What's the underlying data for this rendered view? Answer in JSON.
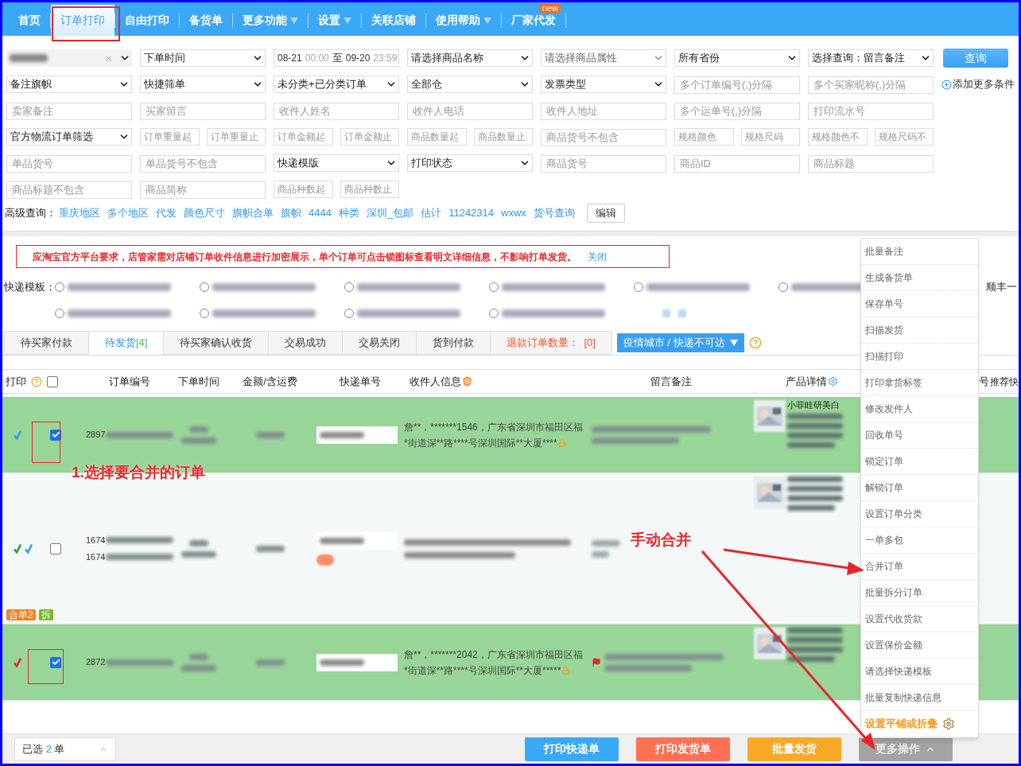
{
  "nav": {
    "items": [
      {
        "label": "首页",
        "selected": false,
        "dropdown": false
      },
      {
        "label": "订单打印",
        "selected": true,
        "dropdown": false
      },
      {
        "label": "自由打印",
        "selected": false,
        "dropdown": false
      },
      {
        "label": "备货单",
        "selected": false,
        "dropdown": false
      },
      {
        "label": "更多功能",
        "selected": false,
        "dropdown": true
      },
      {
        "label": "设置",
        "selected": false,
        "dropdown": true
      },
      {
        "label": "关联店铺",
        "selected": false,
        "dropdown": false
      },
      {
        "label": "使用帮助",
        "selected": false,
        "dropdown": true
      },
      {
        "label": "厂家代发",
        "selected": false,
        "dropdown": false,
        "badge": "new"
      }
    ]
  },
  "filters": {
    "rows": [
      {
        "cells": [
          {
            "kind": "redacted-select"
          },
          {
            "kind": "select",
            "value": "下单时间"
          },
          {
            "kind": "date",
            "from_date": "08-21",
            "from_time": "00:00",
            "sep": "至",
            "to_date": "09-20",
            "to_time": "23:59"
          },
          {
            "kind": "select",
            "value": "请选择商品名称"
          },
          {
            "kind": "muted-select",
            "value": "请选择商品属性"
          },
          {
            "kind": "select",
            "value": "所有省份"
          },
          {
            "kind": "select",
            "value": "选择查询：留言备注"
          }
        ],
        "action": {
          "kind": "button",
          "label": "查询"
        }
      },
      {
        "cells": [
          {
            "kind": "select",
            "value": "备注旗帜"
          },
          {
            "kind": "select",
            "value": "快捷筛单"
          },
          {
            "kind": "select",
            "value": "未分类+已分类订单"
          },
          {
            "kind": "select",
            "value": "全部仓"
          },
          {
            "kind": "select",
            "value": "发票类型"
          },
          {
            "kind": "input",
            "placeholder": "多个订单编号(,)分隔"
          },
          {
            "kind": "input",
            "placeholder": "多个买家昵称(,)分隔"
          }
        ],
        "action": {
          "kind": "link",
          "label": "添加更多条件"
        }
      },
      {
        "cells": [
          {
            "kind": "input",
            "placeholder": "卖家备注"
          },
          {
            "kind": "input",
            "placeholder": "买家留言"
          },
          {
            "kind": "input",
            "placeholder": "收件人姓名"
          },
          {
            "kind": "input",
            "placeholder": "收件人电话"
          },
          {
            "kind": "input",
            "placeholder": "收件人地址"
          },
          {
            "kind": "input",
            "placeholder": "多个运单号(,)分隔"
          },
          {
            "kind": "input",
            "placeholder": "打印流水号"
          }
        ]
      },
      {
        "cells": [
          {
            "kind": "select",
            "value": "官方物流订单筛选"
          },
          {
            "kind": "pair",
            "fields": [
              {
                "kind": "input",
                "placeholder": "订单重量起"
              },
              {
                "kind": "input",
                "placeholder": "订单重量止"
              }
            ]
          },
          {
            "kind": "pair",
            "fields": [
              {
                "kind": "input",
                "placeholder": "订单金额起"
              },
              {
                "kind": "input",
                "placeholder": "订单金额止"
              }
            ]
          },
          {
            "kind": "pair",
            "fields": [
              {
                "kind": "input",
                "placeholder": "商品数量起"
              },
              {
                "kind": "input",
                "placeholder": "商品数量止"
              }
            ]
          },
          {
            "kind": "input",
            "placeholder": "商品货号不包含"
          },
          {
            "kind": "pair",
            "fields": [
              {
                "kind": "input",
                "placeholder": "规格颜色"
              },
              {
                "kind": "input",
                "placeholder": "规格尺码"
              }
            ]
          },
          {
            "kind": "pair",
            "fields": [
              {
                "kind": "input",
                "placeholder": "规格颜色不"
              },
              {
                "kind": "input",
                "placeholder": "规格尺码不"
              }
            ]
          }
        ]
      },
      {
        "cells": [
          {
            "kind": "input",
            "placeholder": "单品货号"
          },
          {
            "kind": "input",
            "placeholder": "单品货号不包含"
          },
          {
            "kind": "select",
            "value": "快递模版"
          },
          {
            "kind": "select",
            "value": "打印状态"
          },
          {
            "kind": "input",
            "placeholder": "商品货号"
          },
          {
            "kind": "input",
            "placeholder": "商品ID"
          },
          {
            "kind": "input",
            "placeholder": "商品标题"
          }
        ]
      },
      {
        "cells": [
          {
            "kind": "input",
            "placeholder": "商品标题不包含"
          },
          {
            "kind": "input",
            "placeholder": "商品简称"
          },
          {
            "kind": "pair",
            "fields": [
              {
                "kind": "input",
                "placeholder": "商品种数起"
              },
              {
                "kind": "input",
                "placeholder": "商品种数止"
              }
            ]
          }
        ]
      }
    ]
  },
  "advanced": {
    "label": "高级查询：",
    "links": [
      "重庆地区",
      "多个地区",
      "代发",
      "颜色尺寸",
      "旗帜合单",
      "旗帜",
      "4444",
      "种类",
      "深圳_包邮",
      "估计",
      "11242314",
      "wxwx",
      "货号查询"
    ],
    "edit_button": "编辑"
  },
  "notice": {
    "text": "应淘宝官方平台要求，店管家需对店铺订单收件信息进行加密展示，单个订单可点击锁图标查看明文详细信息，不影响打单发货。",
    "close": "关闭"
  },
  "templates": {
    "label": "快递模板：",
    "rows": [
      {
        "options": [
          {
            "selected": false
          },
          {
            "selected": false
          },
          {
            "selected": false
          },
          {
            "selected": false
          },
          {
            "selected": false
          },
          {
            "selected": false
          }
        ],
        "trailing": "顺丰一"
      },
      {
        "options": [
          {
            "selected": false
          },
          {
            "selected": false
          },
          {
            "selected": false
          },
          {
            "selected": false
          }
        ]
      }
    ]
  },
  "tabs": [
    {
      "label": "待买家付款",
      "selected": false,
      "kind": "normal"
    },
    {
      "label": "待发货",
      "count": "[4]",
      "selected": true,
      "kind": "normal"
    },
    {
      "label": "待买家确认收货",
      "selected": false,
      "kind": "normal"
    },
    {
      "label": "交易成功",
      "selected": false,
      "kind": "normal"
    },
    {
      "label": "交易关闭",
      "selected": false,
      "kind": "normal"
    },
    {
      "label": "货到付款",
      "selected": false,
      "kind": "normal"
    },
    {
      "label": "退款订单数量：",
      "count": "[0]",
      "selected": false,
      "kind": "alert"
    }
  ],
  "tab_action": "疫情城市 / 快递不可达",
  "table": {
    "all_selected": false,
    "columns": [
      {
        "label": "打印",
        "kind": "print"
      },
      {
        "label": "订单编号",
        "kind": "text"
      },
      {
        "label": "下单时间",
        "kind": "text"
      },
      {
        "label": "金额/含运费",
        "kind": "text"
      },
      {
        "label": "快递单号",
        "kind": "text"
      },
      {
        "label": "收件人信息",
        "kind": "recipient"
      },
      {
        "label": "留言备注",
        "kind": "text"
      },
      {
        "label": "产品详情",
        "kind": "product"
      },
      {
        "label": "号",
        "kind": "end"
      },
      {
        "label": "推荐快",
        "kind": "text"
      }
    ],
    "rows": [
      {
        "selected": true,
        "marks": [
          {
            "color": "#29a3f0"
          }
        ],
        "order_numbers": [
          "2897"
        ],
        "recipient": "詹**，*******1546，广东省深圳市福田区福*街道深**路****号深圳国际**大厦****",
        "flag": false,
        "product_title": "小菲眭研美白"
      },
      {
        "selected": false,
        "marks": [
          {
            "color": "#2f9e2f"
          },
          {
            "color": "#29a3f0"
          }
        ],
        "order_numbers": [
          "1674",
          "1674"
        ],
        "flag": false,
        "tags": [
          {
            "label": "合单2",
            "color": "#f5811f"
          },
          {
            "label": "拆",
            "color": "#7bb62b"
          }
        ]
      },
      {
        "selected": true,
        "marks": [
          {
            "color": "#e8262a"
          }
        ],
        "order_numbers": [
          "2872"
        ],
        "recipient": "詹**，*******2042，广东省深圳市福田区福*街道深**路****号深圳国际**大厦*****",
        "flag": true
      }
    ]
  },
  "menu": {
    "items": [
      {
        "label": "批量备注",
        "kind": "item"
      },
      {
        "label": "生成备货单",
        "kind": "item"
      },
      {
        "label": "保存单号",
        "kind": "item"
      },
      {
        "label": "扫描发货",
        "kind": "item"
      },
      {
        "label": "扫描打印",
        "kind": "item"
      },
      {
        "label": "打印拿货标签",
        "kind": "item"
      },
      {
        "label": "修改发件人",
        "kind": "item"
      },
      {
        "label": "回收单号",
        "kind": "item"
      },
      {
        "label": "锁定订单",
        "kind": "item"
      },
      {
        "label": "解锁订单",
        "kind": "item"
      },
      {
        "label": "设置订单分类",
        "kind": "item"
      },
      {
        "label": "一单多包",
        "kind": "item"
      },
      {
        "label": "合并订单",
        "kind": "item"
      },
      {
        "label": "批量拆分订单",
        "kind": "item"
      },
      {
        "label": "设置代收货款",
        "kind": "item"
      },
      {
        "label": "设置保价金额",
        "kind": "item"
      },
      {
        "label": "请选择快递模板",
        "kind": "item"
      },
      {
        "label": "批量复制快递信息",
        "kind": "item"
      },
      {
        "label": "设置平铺或折叠",
        "kind": "setting"
      }
    ]
  },
  "bottom": {
    "selected_prefix": "已选",
    "selected_count": "2",
    "selected_suffix": "单",
    "buttons": [
      {
        "label": "打印快递单",
        "color": "#3aa9f5"
      },
      {
        "label": "打印发货单",
        "color": "#ff7152"
      },
      {
        "label": "批量发货",
        "color": "#f8a928"
      }
    ],
    "more": "更多操作"
  },
  "annotations": {
    "step": "1.选择要合并的订单",
    "merge": "手动合并"
  }
}
